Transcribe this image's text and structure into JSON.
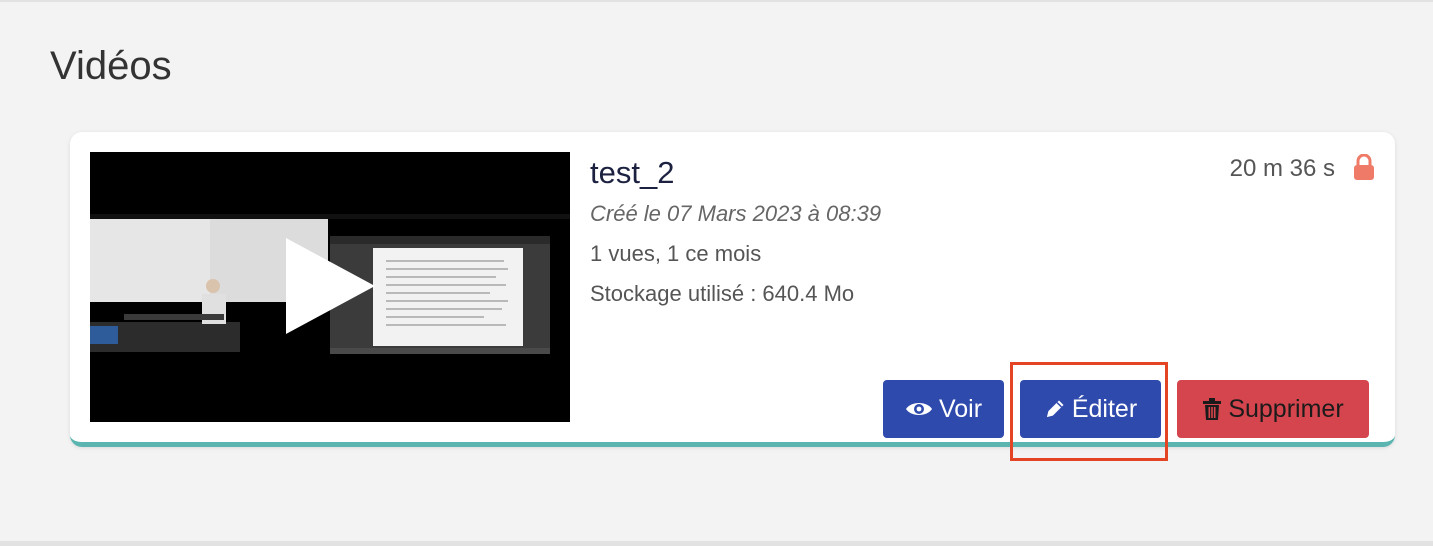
{
  "page": {
    "title": "Vidéos"
  },
  "video": {
    "title": "test_2",
    "created": "Créé le 07 Mars 2023 à 08:39",
    "views": "1 vues, 1 ce mois",
    "storage": "Stockage utilisé : 640.4 Mo",
    "duration": "20 m 36 s",
    "lock_icon": "lock-icon",
    "thumbnail_icon": "play-icon"
  },
  "actions": {
    "view_label": "Voir",
    "view_icon": "eye-icon",
    "edit_label": "Éditer",
    "edit_icon": "pencil-icon",
    "delete_label": "Supprimer",
    "delete_icon": "trash-icon"
  },
  "colors": {
    "primary_button": "#2f4aad",
    "danger_button": "#d5454d",
    "card_accent": "#5ab5b0",
    "lock": "#ef7a68",
    "highlight": "#e34524"
  }
}
